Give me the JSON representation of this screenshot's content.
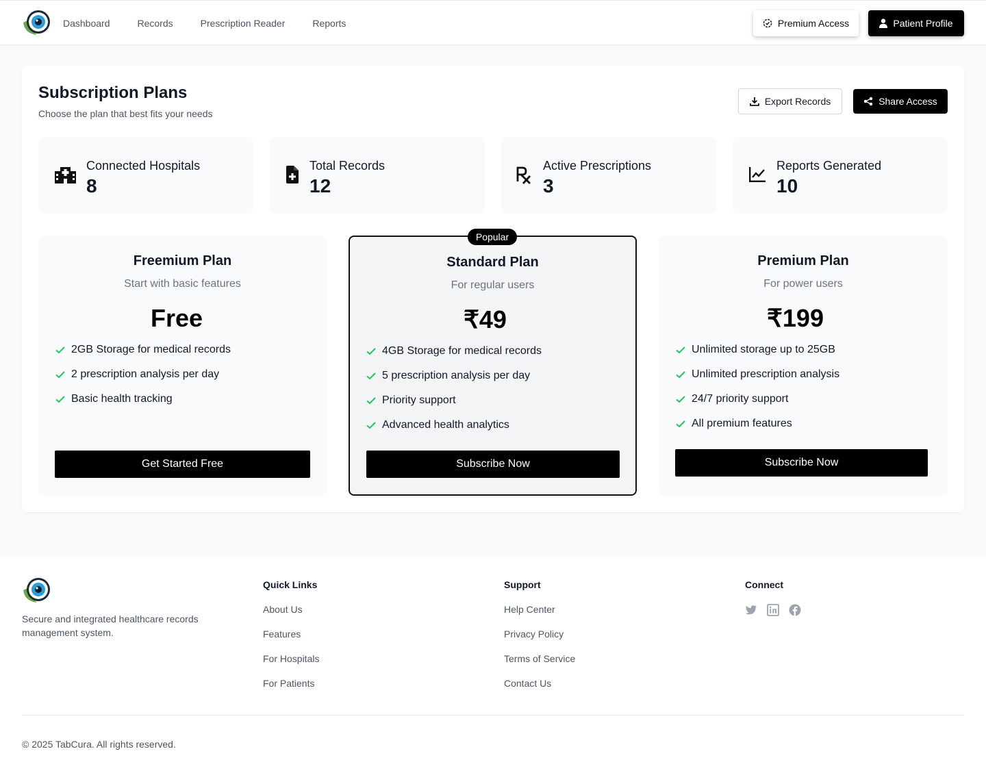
{
  "header": {
    "nav": [
      "Dashboard",
      "Records",
      "Prescription Reader",
      "Reports"
    ],
    "premium_label": "Premium Access",
    "profile_label": "Patient Profile"
  },
  "page": {
    "title": "Subscription Plans",
    "subtitle": "Choose the plan that best fits your needs",
    "export_label": "Export Records",
    "share_label": "Share Access"
  },
  "stats": [
    {
      "label": "Connected Hospitals",
      "value": "8",
      "icon": "hospital-icon"
    },
    {
      "label": "Total Records",
      "value": "12",
      "icon": "file-medical-icon"
    },
    {
      "label": "Active Prescriptions",
      "value": "3",
      "icon": "prescription-icon"
    },
    {
      "label": "Reports Generated",
      "value": "10",
      "icon": "chart-line-icon"
    }
  ],
  "plans": [
    {
      "name": "Freemium Plan",
      "description": "Start with basic features",
      "price": "Free",
      "features": [
        "2GB Storage for medical records",
        "2 prescription analysis per day",
        "Basic health tracking"
      ],
      "button": "Get Started Free"
    },
    {
      "name": "Standard Plan",
      "description": "For regular users",
      "price": "₹49",
      "badge": "Popular",
      "features": [
        "4GB Storage for medical records",
        "5 prescription analysis per day",
        "Priority support",
        "Advanced health analytics"
      ],
      "button": "Subscribe Now"
    },
    {
      "name": "Premium Plan",
      "description": "For power users",
      "price": "₹199",
      "features": [
        "Unlimited storage up to 25GB",
        "Unlimited prescription analysis",
        "24/7 priority support",
        "All premium features"
      ],
      "button": "Subscribe Now"
    }
  ],
  "footer": {
    "tagline": "Secure and integrated healthcare records management system.",
    "quick_links": {
      "title": "Quick Links",
      "items": [
        "About Us",
        "Features",
        "For Hospitals",
        "For Patients"
      ]
    },
    "support": {
      "title": "Support",
      "items": [
        "Help Center",
        "Privacy Policy",
        "Terms of Service",
        "Contact Us"
      ]
    },
    "connect": {
      "title": "Connect",
      "icons": [
        "twitter-icon",
        "linkedin-icon",
        "facebook-icon"
      ]
    },
    "copyright": "© 2025 TabCura. All rights reserved."
  },
  "colors": {
    "accent": "#000000",
    "check": "#22c55e",
    "logo_green": "#6aa84f",
    "logo_blue": "#2a9fd6"
  }
}
